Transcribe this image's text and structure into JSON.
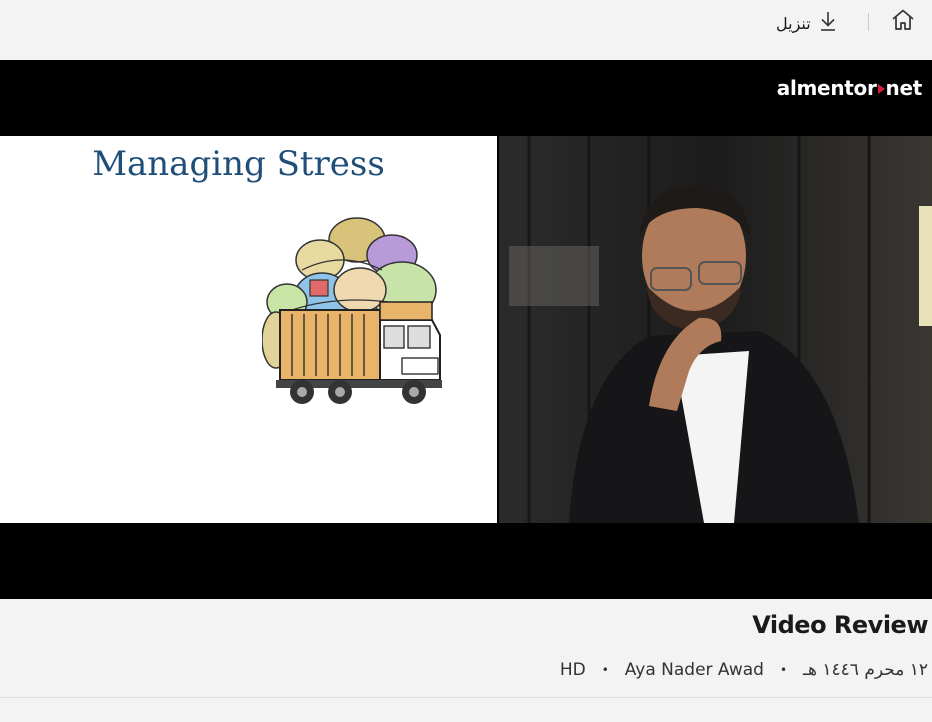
{
  "toolbar": {
    "home_icon": "home-icon",
    "download_label": "تنزيل",
    "download_icon": "download-icon"
  },
  "player": {
    "brand": {
      "part1": "almentor",
      "part2": "net"
    },
    "slide_title": "Managing Stress"
  },
  "video": {
    "title": "Video Review",
    "date": "١٢ محرم ١٤٤٦ هـ",
    "author": "Aya Nader Awad",
    "quality": "HD",
    "separator": "•"
  },
  "colors": {
    "slide_title": "#1f4e79",
    "brand_play": "#d0213a",
    "player_bg": "#000000",
    "page_bg": "#f3f3f3"
  }
}
